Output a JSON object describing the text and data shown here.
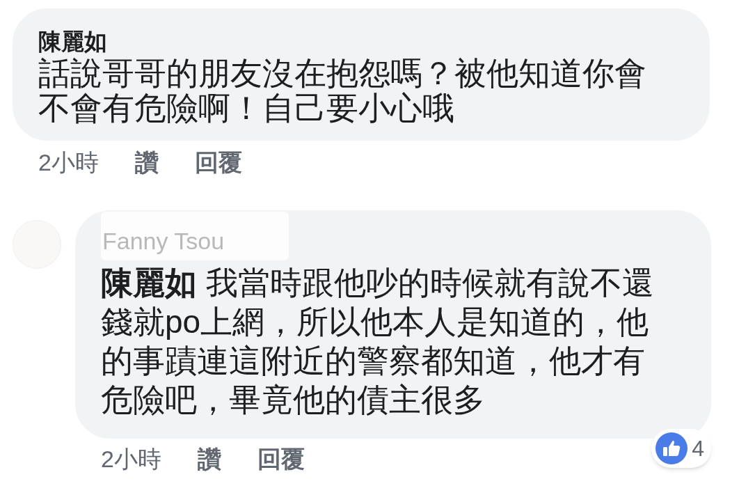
{
  "comments": [
    {
      "author": "陳麗如",
      "text": "話說哥哥的朋友沒在抱怨嗎？被他知道你會不會有危險啊！自己要小心哦",
      "meta": {
        "time": "2小時",
        "like": "讚",
        "reply": "回覆"
      }
    }
  ],
  "reply": {
    "author": "Fanny Tsou",
    "text": "**陳麗如** 我當時跟他吵的時候就有說不還錢就po上網，所以他本人是知道的，他的事蹟連這附近的警察都知道，他才有危險吧，畢竟他的債主很多",
    "reactions": {
      "count": "4"
    },
    "meta": {
      "time": "2小時",
      "like": "讚",
      "reply": "回覆"
    }
  }
}
